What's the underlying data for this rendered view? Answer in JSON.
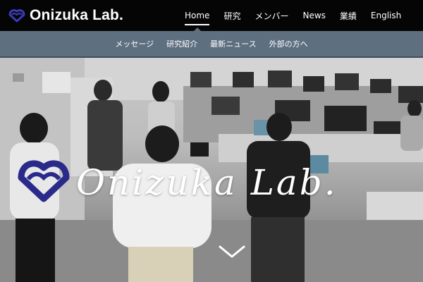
{
  "brand": {
    "name": "Onizuka Lab.",
    "logo_icon": "lab-logo-icon"
  },
  "main_nav": [
    {
      "label": "Home",
      "active": true
    },
    {
      "label": "研究",
      "active": false
    },
    {
      "label": "メンバー",
      "active": false
    },
    {
      "label": "News",
      "active": false
    },
    {
      "label": "業績",
      "active": false
    },
    {
      "label": "English",
      "active": false
    }
  ],
  "sub_nav": [
    "メッセージ",
    "研究紹介",
    "最新ニュース",
    "外部の方へ"
  ],
  "hero": {
    "title": "Onizuka Lab.",
    "logo_icon": "lab-logo-icon",
    "scroll_icon": "chevron-down-icon"
  },
  "colors": {
    "topbar": "#050505",
    "subnav": "#5e6f80",
    "logo": "#2a2a8a",
    "text": "#ffffff"
  }
}
